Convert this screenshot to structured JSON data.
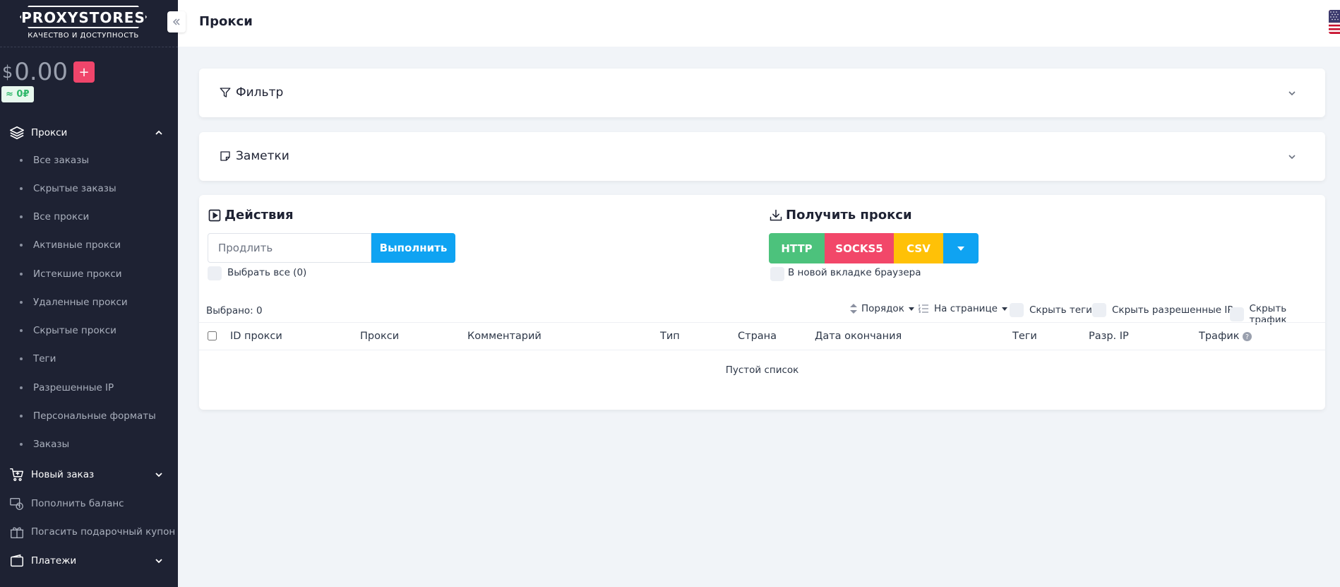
{
  "brand": {
    "name": "PROXYSTORES",
    "tagline": "КАЧЕСТВО И ДОСТУПНОСТЬ"
  },
  "balance": {
    "currency": "$",
    "amount": "0.00",
    "add_label": "+",
    "rub": "≈ 0₽"
  },
  "sidebar": {
    "proxy_section": {
      "label": "Прокси",
      "icon": "layers-icon"
    },
    "sub_items": [
      "Все заказы",
      "Скрытые заказы",
      "Все прокси",
      "Активные прокси",
      "Истекшие прокси",
      "Удаленные прокси",
      "Скрытые прокси",
      "Теги",
      "Разрешенные IP",
      "Персональные форматы",
      "Заказы"
    ],
    "new_order": {
      "label": "Новый заказ",
      "icon": "cart-icon"
    },
    "top_up": {
      "label": "Пополнить баланс",
      "icon": "coins-icon"
    },
    "coupon": {
      "label": "Погасить подарочный купон",
      "icon": "gift-icon"
    },
    "payments": {
      "label": "Платежи",
      "icon": "wallet-icon"
    }
  },
  "header": {
    "title": "Прокси",
    "language_flag": "us-flag-icon",
    "theme_icon": "sun-icon"
  },
  "filter": {
    "title": "Фильтр"
  },
  "notes": {
    "title": "Заметки"
  },
  "actions": {
    "title": "Действия",
    "input_value": "Продлить",
    "execute_label": "Выполнить",
    "select_all": "Выбрать все (0)"
  },
  "get_proxy": {
    "title": "Получить прокси",
    "formats": [
      "HTTP",
      "SOCKS5",
      "CSV"
    ],
    "format_colors": [
      "#4cc27c",
      "#f24769",
      "#ffc107"
    ],
    "dropdown_color": "#0fa3f2",
    "new_tab": "В новой вкладке браузера"
  },
  "toolbar": {
    "selected": "Выбрано: 0",
    "order": "Порядок",
    "per_page": "На странице",
    "hide_tags": "Скрыть теги",
    "hide_allowed_ip": "Скрыть разрешенные IP",
    "hide_traffic": "Скрыть трафик"
  },
  "table": {
    "columns": [
      "ID прокси",
      "Прокси",
      "Комментарий",
      "Тип",
      "Страна",
      "Дата окончания",
      "Теги",
      "Разр. IP",
      "Трафик"
    ],
    "empty_text": "Пустой список"
  }
}
